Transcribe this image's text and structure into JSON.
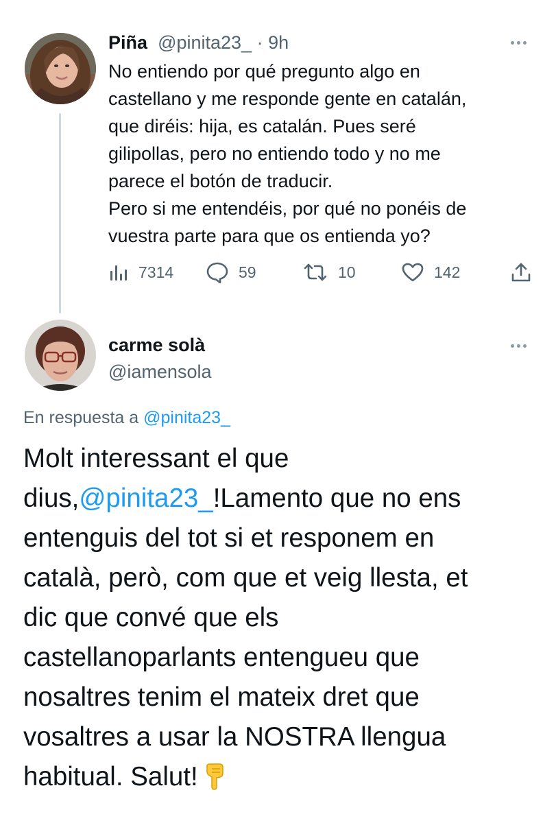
{
  "tweet1": {
    "author_name": "Piña",
    "handle": "@pinita23_",
    "separator": " · ",
    "time": "9h",
    "text_lines": [
      "No entiendo por qué pregunto algo en",
      "castellano y me responde gente en catalán,",
      "que diréis: hija, es catalán. Pues seré",
      "gilipollas, pero no entiendo todo y no me",
      "parece el botón de traducir.",
      "Pero si me entendéis, por qué no ponéis de",
      "vuestra parte para que os entienda yo?"
    ],
    "stats": {
      "views": "7314",
      "replies": "59",
      "retweets": "10",
      "likes": "142"
    }
  },
  "tweet2": {
    "author_name": "carme solà",
    "handle": "@iamensola",
    "reply_prefix": "En respuesta a ",
    "reply_handle": "@pinita23_",
    "text": {
      "l1": "Molt interessant el que",
      "l2_pre": "dius,",
      "l2_mention": "@pinita23_",
      "l2_post": "!Lamento que no ens",
      "l3": "entenguis del tot si et responem en",
      "l4": "català, però, com que et veig llesta, et",
      "l5": "dic que convé que els",
      "l6": "castellanoparlants entengueu que",
      "l7": "nosaltres tenim el mateix dret que",
      "l8": "vosaltres a usar la NOSTRA llengua",
      "l9": "habitual. Salut!"
    }
  },
  "icons": {
    "views": "bar-chart-icon",
    "reply": "speech-bubble-icon",
    "retweet": "retweet-icon",
    "like": "heart-icon",
    "share": "share-icon",
    "more": "more-dots-icon",
    "emoji": "backhand-index-pointing-down-emoji"
  },
  "colors": {
    "text": "#0f1419",
    "secondary": "#536471",
    "link": "#1d9bf0",
    "thread_line": "#cfd9de"
  }
}
